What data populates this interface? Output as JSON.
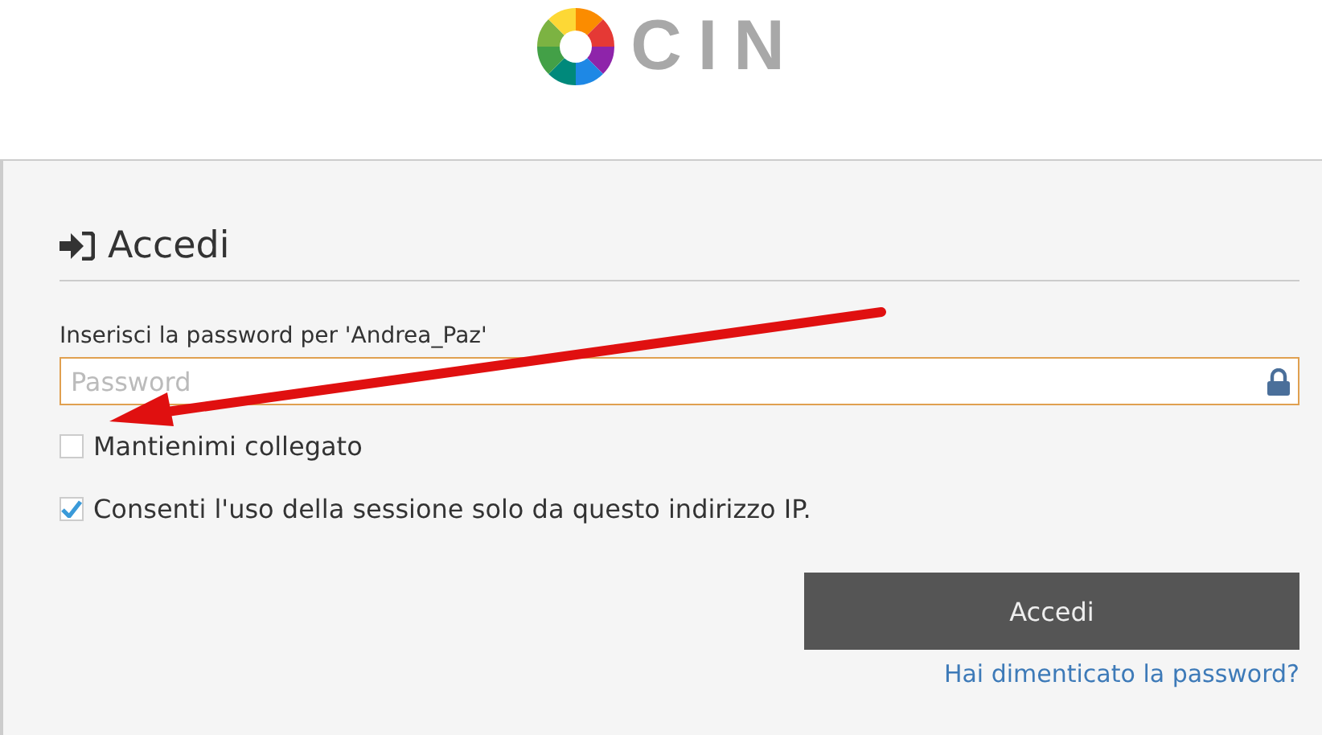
{
  "logo": {
    "text": "CIN"
  },
  "panel": {
    "title": "Accedi",
    "field_label": "Inserisci la password per 'Andrea_Paz'",
    "password": {
      "placeholder": "Password"
    },
    "options": [
      {
        "label": "Mantienimi collegato",
        "checked": false
      },
      {
        "label": "Consenti l'uso della sessione solo da questo indirizzo IP.",
        "checked": true
      }
    ],
    "submit": "Accedi",
    "forgot_link": "Hai dimenticato la password?"
  }
}
